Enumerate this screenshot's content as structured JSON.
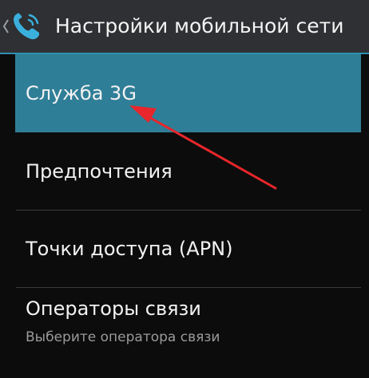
{
  "action_bar": {
    "title": "Настройки мобильной сети",
    "back_icon": "chevron-left-icon",
    "app_icon": "phone-icon",
    "accent_color": "#2f8fb0"
  },
  "list": {
    "items": [
      {
        "title": "Служба 3G",
        "subtitle": "",
        "selected": true
      },
      {
        "title": "Предпочтения",
        "subtitle": ""
      },
      {
        "title": "Точки доступа (APN)",
        "subtitle": ""
      },
      {
        "title": "Операторы связи",
        "subtitle": "Выберите оператора связи"
      }
    ],
    "selected_color": "#2f7e97"
  },
  "annotation": {
    "type": "red-arrow",
    "points_to": "Служба 3G",
    "color": "#e8262b"
  }
}
